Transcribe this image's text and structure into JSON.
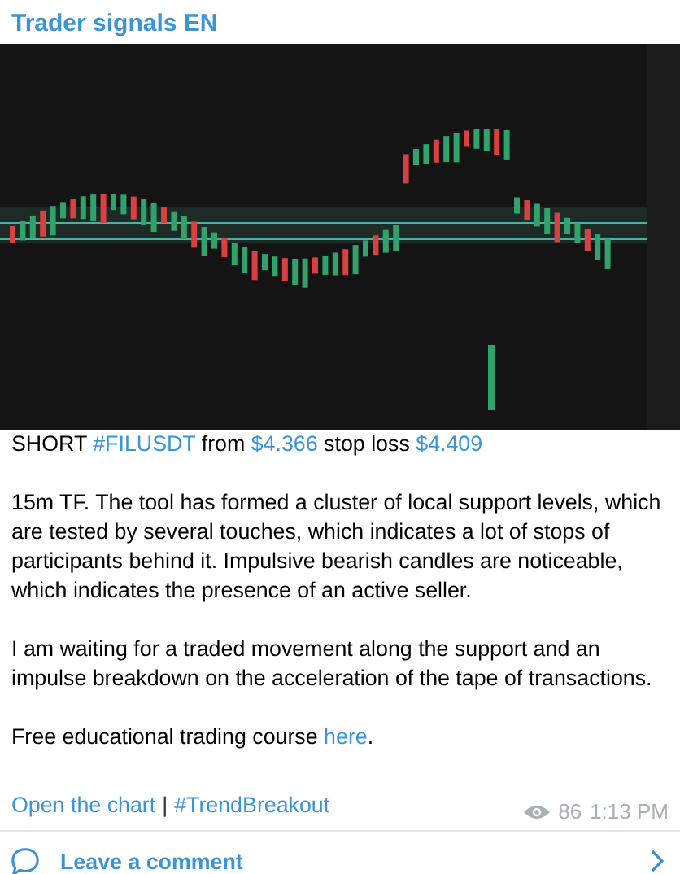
{
  "channel": {
    "title": "Trader signals EN"
  },
  "post": {
    "image": {
      "kind": "picture"
    },
    "paragraphs": [
      [
        {
          "kind": "text",
          "text": "SHORT "
        },
        {
          "kind": "link",
          "text": "#FILUSDT"
        },
        {
          "kind": "text",
          "text": " from "
        },
        {
          "kind": "link",
          "text": "$4.366"
        },
        {
          "kind": "text",
          "text": " stop loss "
        },
        {
          "kind": "link",
          "text": "$4.409"
        }
      ],
      [
        {
          "kind": "text",
          "text": "15m TF. The tool has formed a cluster of local support levels, which are tested by several touches, which indicates a lot of stops of participants behind it. Impulsive bearish candles are noticeable, which indicates the presence of an active seller."
        }
      ],
      [
        {
          "kind": "text",
          "text": "I am waiting for a traded movement along the support and an impulse breakdown on the acceleration of the tape of transactions."
        }
      ],
      [
        {
          "kind": "text",
          "text": "Free educational trading course "
        },
        {
          "kind": "link",
          "text": "here"
        },
        {
          "kind": "text",
          "text": "."
        }
      ]
    ],
    "footer_links": [
      "Open the chart",
      "#TrendBreakout"
    ],
    "separator": "|",
    "views": "86",
    "time": "1:13 PM"
  },
  "comments": {
    "label": "Leave a comment"
  }
}
